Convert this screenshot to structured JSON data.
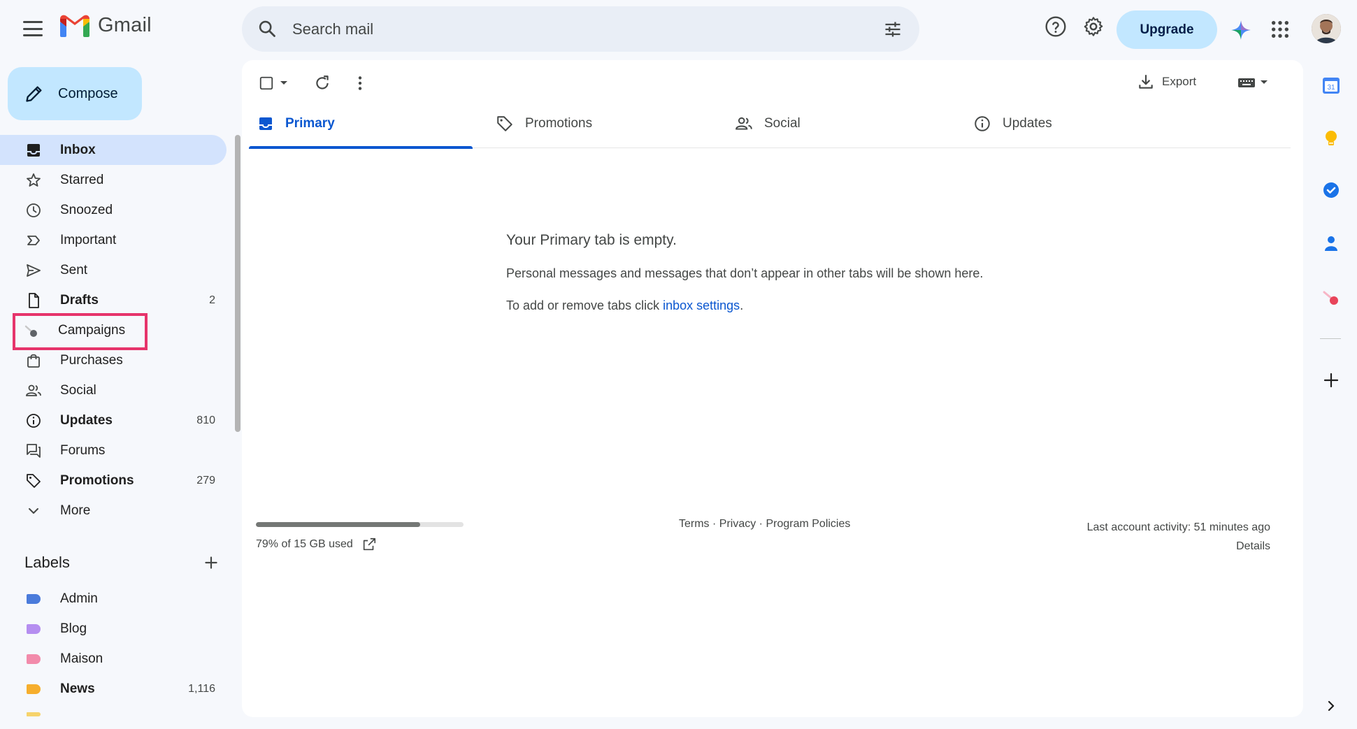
{
  "header": {
    "app_name": "Gmail",
    "search_placeholder": "Search mail",
    "upgrade_label": "Upgrade"
  },
  "compose": {
    "label": "Compose"
  },
  "sidebar": {
    "items": [
      {
        "label": "Inbox",
        "count": "",
        "icon": "inbox-icon"
      },
      {
        "label": "Starred",
        "count": "",
        "icon": "star-icon"
      },
      {
        "label": "Snoozed",
        "count": "",
        "icon": "clock-icon"
      },
      {
        "label": "Important",
        "count": "",
        "icon": "important-icon"
      },
      {
        "label": "Sent",
        "count": "",
        "icon": "send-icon"
      },
      {
        "label": "Drafts",
        "count": "2",
        "icon": "file-icon"
      },
      {
        "label": "Campaigns",
        "count": "",
        "icon": "campaigns-icon"
      },
      {
        "label": "Purchases",
        "count": "",
        "icon": "bag-icon"
      },
      {
        "label": "Social",
        "count": "",
        "icon": "people-icon"
      },
      {
        "label": "Updates",
        "count": "810",
        "icon": "info-icon"
      },
      {
        "label": "Forums",
        "count": "",
        "icon": "forum-icon"
      },
      {
        "label": "Promotions",
        "count": "279",
        "icon": "tag-icon"
      },
      {
        "label": "More",
        "count": "",
        "icon": "chevron-down-icon"
      }
    ],
    "labels_title": "Labels",
    "labels": [
      {
        "label": "Admin",
        "count": "",
        "color": "#4a7bdb"
      },
      {
        "label": "Blog",
        "count": "",
        "color": "#b58ef0"
      },
      {
        "label": "Maison",
        "count": "",
        "color": "#f28bab"
      },
      {
        "label": "News",
        "count": "1,116",
        "color": "#f6ae2d"
      }
    ]
  },
  "toolbar": {
    "export_label": "Export"
  },
  "tabs": [
    {
      "label": "Primary",
      "icon": "inbox-icon"
    },
    {
      "label": "Promotions",
      "icon": "tag-icon"
    },
    {
      "label": "Social",
      "icon": "people-icon"
    },
    {
      "label": "Updates",
      "icon": "info-icon"
    }
  ],
  "empty_state": {
    "title": "Your Primary tab is empty.",
    "line1": "Personal messages and messages that don’t appear in other tabs will be shown here.",
    "line2_prefix": "To add or remove tabs click ",
    "line2_link": "inbox settings",
    "line2_suffix": "."
  },
  "footer": {
    "storage_text": "79% of 15 GB used",
    "storage_fraction": 0.79,
    "terms": "Terms",
    "privacy": "Privacy",
    "policies": "Program Policies",
    "separator": " · ",
    "activity": "Last account activity: 51 minutes ago",
    "details": "Details"
  },
  "right_rail": {
    "calendar_day": "31"
  },
  "colors": {
    "accent": "#0b57d0",
    "compose_bg": "#c2e7ff",
    "active_nav_bg": "#d3e3fd",
    "highlight_box": "#e6346b"
  }
}
